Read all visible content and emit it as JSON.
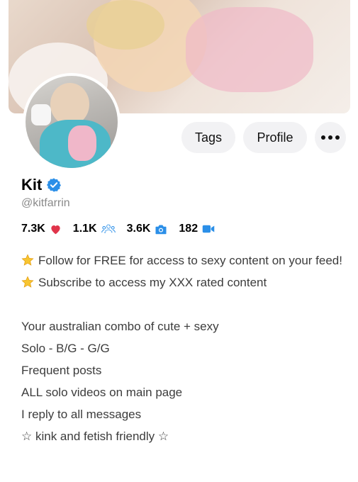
{
  "profile": {
    "name": "Kit",
    "handle": "@kitfarrin"
  },
  "buttons": {
    "tags": "Tags",
    "profile": "Profile"
  },
  "stats": {
    "likes": "7.3K",
    "subscribers": "1.1K",
    "photos": "3.6K",
    "videos": "182"
  },
  "bio": {
    "line1": "Follow for FREE for access to sexy content on your feed!",
    "line2": "Subscribe to access my XXX rated content",
    "line3": "Your australian combo of cute + sexy",
    "line4": "Solo - B/G - G/G",
    "line5": "Frequent posts",
    "line6": "ALL solo videos on main page",
    "line7": "I reply to all messages",
    "line8": "☆ kink and fetish friendly ☆"
  },
  "colors": {
    "verified": "#2b8fe8",
    "heart": "#e0344a",
    "stat_icon": "#2b8fe8"
  }
}
